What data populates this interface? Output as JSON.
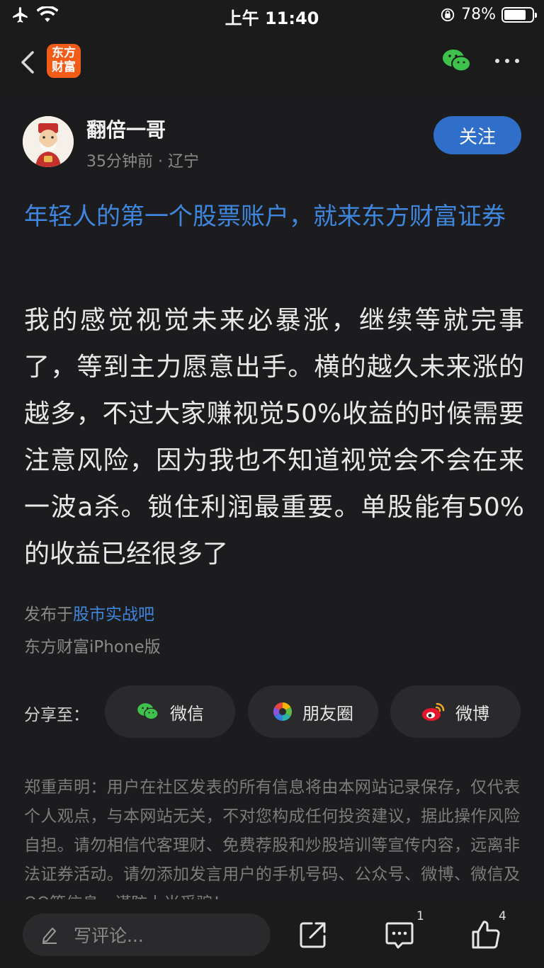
{
  "status_bar": {
    "time": "上午 11:40",
    "battery": "78%",
    "battery_level": 0.78
  },
  "post": {
    "author": "翻倍一哥",
    "meta": "35分钟前 · 辽宁",
    "follow_label": "关注",
    "title": "年轻人的第一个股票账户，就来东方财富证券",
    "body": "我的感觉视觉未来必暴涨，继续等就完事了，等到主力愿意出手。横的越久未来涨的越多，不过大家赚视觉50%收益的时候需要注意风险，因为我也不知道视觉会不会在来一波a杀。锁住利润最重要。单股能有50%的收益已经很多了",
    "published_prefix": "发布于",
    "forum": "股市实战吧",
    "device": "东方财富iPhone版"
  },
  "app": {
    "logo_line1": "东方",
    "logo_line2": "财富"
  },
  "share": {
    "label": "分享至：",
    "buttons": [
      {
        "label": "微信",
        "icon": "wechat-icon"
      },
      {
        "label": "朋友圈",
        "icon": "moments-icon"
      },
      {
        "label": "微博",
        "icon": "weibo-icon"
      }
    ]
  },
  "disclaimer": "郑重声明：用户在社区发表的所有信息将由本网站记录保存，仅代表个人观点，与本网站无关，不对您构成任何投资建议，据此操作风险自担。请勿相信代客理财、免费荐股和炒股培训等宣传内容，远离非法证券活动。请勿添加发言用户的手机号码、公众号、微博、微信及QQ等信息，谨防上当受骗！",
  "bottom_bar": {
    "comment_placeholder": "写评论...",
    "comment_count": "1",
    "like_count": "4"
  },
  "colors": {
    "link": "#3f86de",
    "follow": "#2f6fc9",
    "brand": "#f25c19"
  }
}
